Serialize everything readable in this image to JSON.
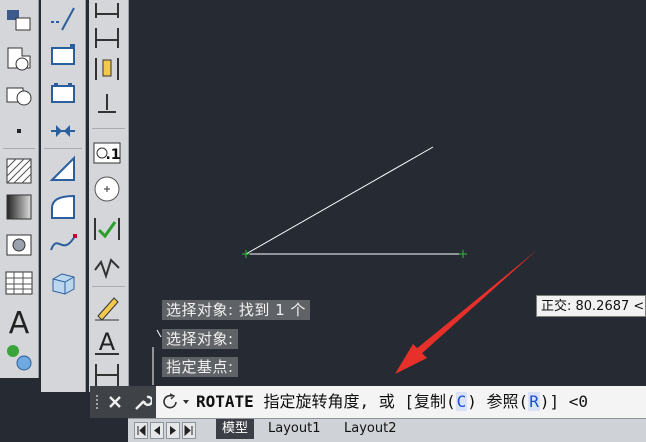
{
  "history": [
    "选择对象: 找到 1 个",
    "选择对象:",
    "指定基点:"
  ],
  "tooltip": {
    "text": "正交: 80.2687 <"
  },
  "command": {
    "name": "ROTATE",
    "prompt": "指定旋转角度, 或 [",
    "option1_label": "复制(",
    "option1_key": "C",
    "option1_end": ")",
    "option2_label": "参照(",
    "option2_key": "R",
    "option2_end": ")",
    "trail": "] <0"
  },
  "tabs": [
    {
      "label": "模型",
      "active": true
    },
    {
      "label": "Layout1",
      "active": false
    },
    {
      "label": "Layout2",
      "active": false
    }
  ],
  "colors": {
    "canvas": "#252a33",
    "drawing_line": "#ffffff",
    "grip": "#2fbf3a",
    "annotation_arrow": "#e8302a"
  },
  "icons": {
    "toolbar1": [
      "draw-order-icon",
      "hatch-icon",
      "region-icon",
      "point-icon",
      "hatch-pattern-icon",
      "gradient-icon",
      "boundary-icon",
      "table-icon",
      "multiline-text-icon",
      "add-selected-icon"
    ],
    "toolbar2": [
      "dimension-linear-icon",
      "dimension-baseline-icon",
      "dimension-continue-icon",
      "dimension-break-icon",
      "dimension-arc-icon",
      "dimension-radius-icon",
      "spline-icon",
      "3d-box-icon"
    ],
    "toolbar3": [
      "dimension-space-icon",
      "dimension-edit-icon",
      "ordinate-icon",
      "tolerance-icon",
      "center-mark-icon",
      "inspect-icon",
      "jog-icon",
      "pencil-icon",
      "text-style-icon"
    ]
  }
}
